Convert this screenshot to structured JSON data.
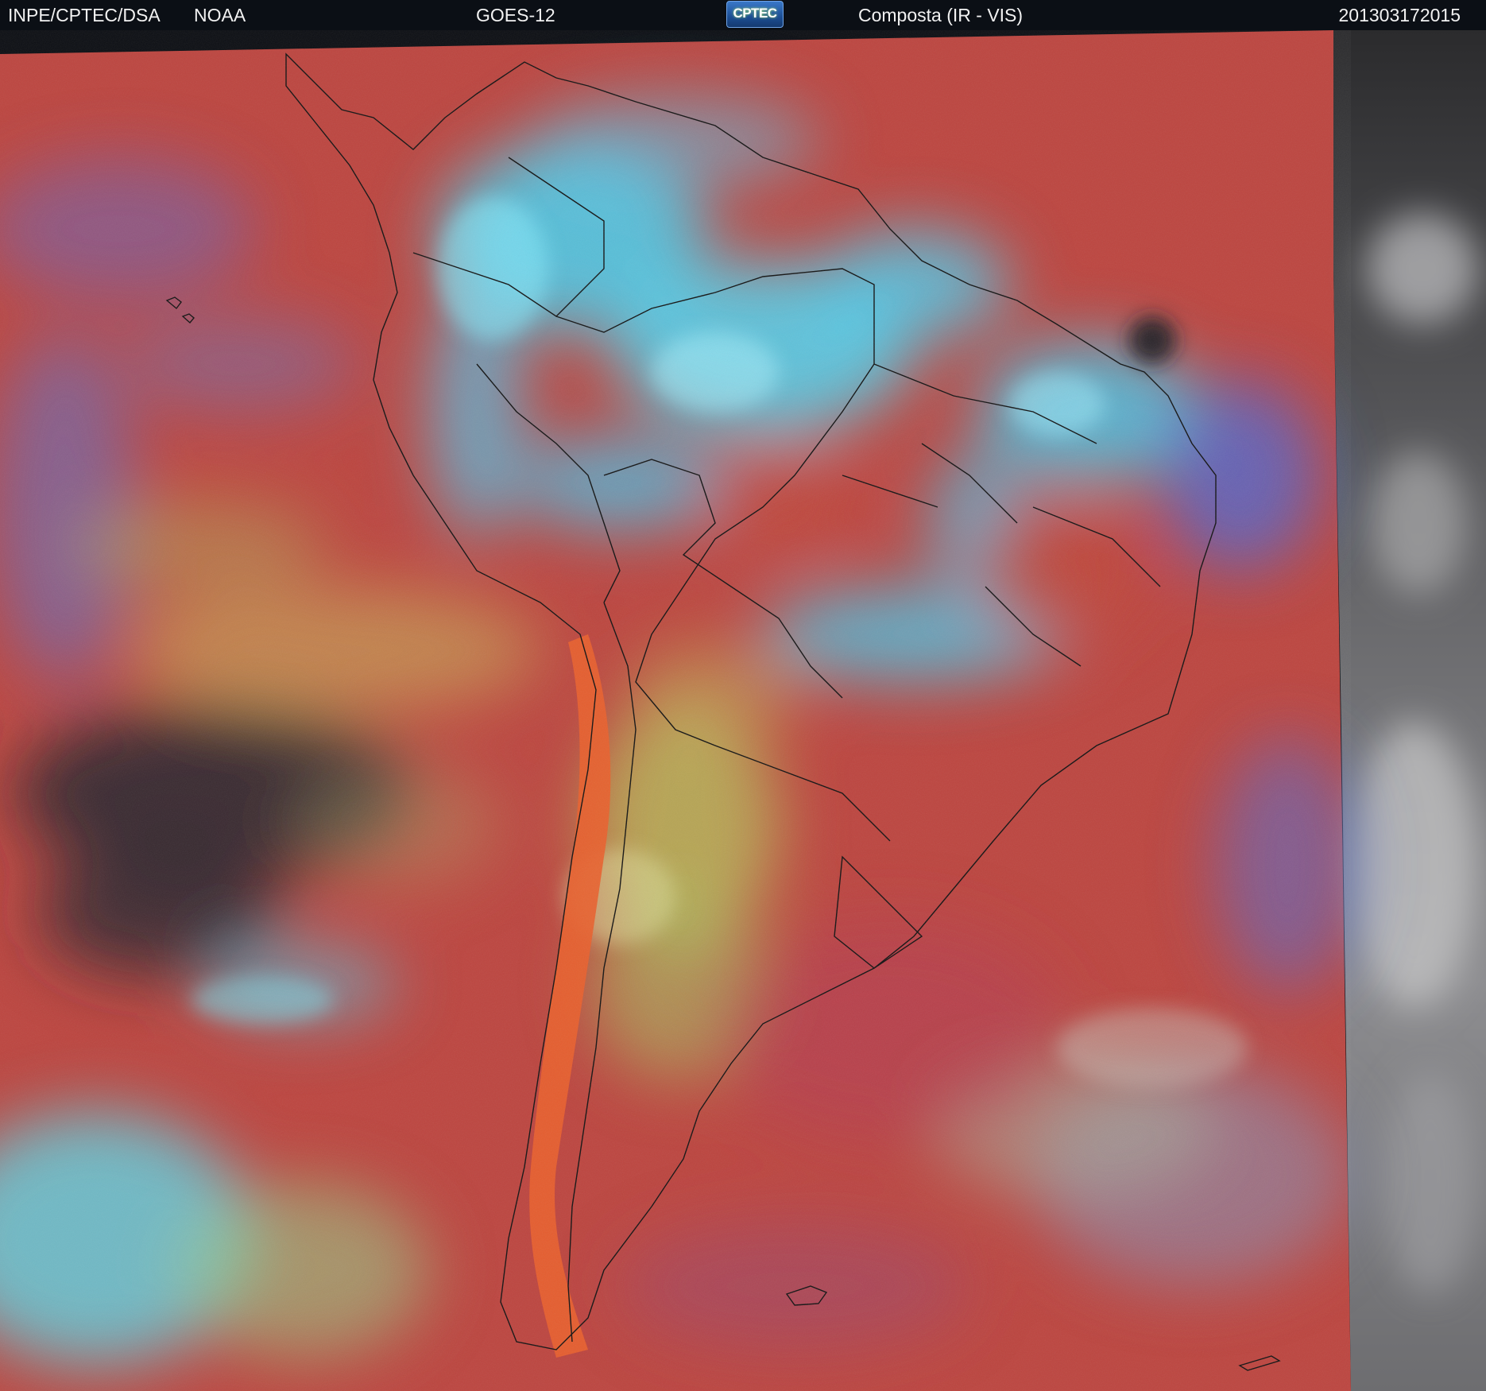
{
  "header": {
    "agency": "INPE/CPTEC/DSA",
    "partner": "NOAA",
    "satellite": "GOES-12",
    "logo_text": "CPTEC",
    "product": "Composta (IR - VIS)",
    "timestamp": "201303172015"
  },
  "map": {
    "region": "South America",
    "colors": {
      "ocean_warm": "#c0463c",
      "land_warm": "#e0552c",
      "cold_cloud": "#3fd4f0",
      "mid_cloud": "#a4c860",
      "low_cloud_blue": "#4f78d8",
      "clear_dark": "#2a2a2e",
      "vis_gray": "#9a9a9a",
      "border_line": "#111111"
    }
  }
}
